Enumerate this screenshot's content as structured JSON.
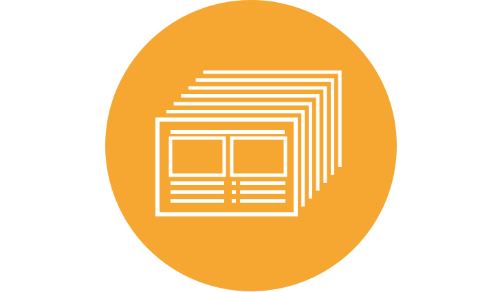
{
  "icon": {
    "name": "stacked-documents-icon",
    "background_shape": "circle",
    "colors": {
      "circle": "#F6A732",
      "glyph": "#FFFFFF",
      "page_background": "#FFFFFF"
    },
    "stacked_page_count": 6
  }
}
